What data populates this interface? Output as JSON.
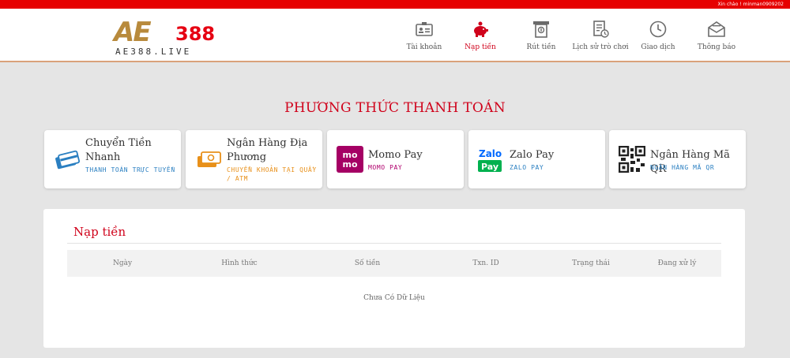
{
  "topbar": {
    "greeting": "Xin chào ! minman0909202"
  },
  "logo": {
    "mark": "AE",
    "number": "388",
    "sub": "AE388.LIVE"
  },
  "nav": [
    {
      "label": "Tài khoản",
      "icon": "account-card-icon"
    },
    {
      "label": "Nạp tiền",
      "icon": "piggy-bank-icon"
    },
    {
      "label": "Rút tiền",
      "icon": "atm-withdraw-icon"
    },
    {
      "label": "Lịch sử trò chơi",
      "icon": "game-history-icon"
    },
    {
      "label": "Giao dịch",
      "icon": "clock-icon"
    },
    {
      "label": "Thông báo",
      "icon": "mail-icon"
    }
  ],
  "page_title": "PHƯƠNG THỨC THANH TOÁN",
  "methods": [
    {
      "title": "Chuyển Tiền Nhanh",
      "sub": "THANH TOÁN TRỰC TUYẾN",
      "sub_color": "#2a7fc1"
    },
    {
      "title": "Ngân Hàng Địa Phương",
      "sub": "CHUYỂN KHOẢN TẠI QUẦY / ATM",
      "sub_color": "#e8901a"
    },
    {
      "title": "Momo Pay",
      "sub": "MOMO PAY",
      "sub_color": "#b0006d"
    },
    {
      "title": "Zalo Pay",
      "sub": "ZALO PAY",
      "sub_color": "#2a7fc1"
    },
    {
      "title": "Ngân Hàng Mã QR",
      "sub": "NGÂN HÀNG MÃ QR",
      "sub_color": "#2a7fc1"
    }
  ],
  "deposit": {
    "title": "Nạp tiền",
    "columns": [
      "Ngày",
      "Hình thức",
      "Số tiền",
      "Txn. ID",
      "Trạng thái",
      "Đang xử lý"
    ],
    "empty": "Chưa Có Dữ Liệu"
  },
  "colors": {
    "accent": "#d0021b",
    "topbar": "#e60000",
    "brand_gold": "#b88a3c"
  }
}
